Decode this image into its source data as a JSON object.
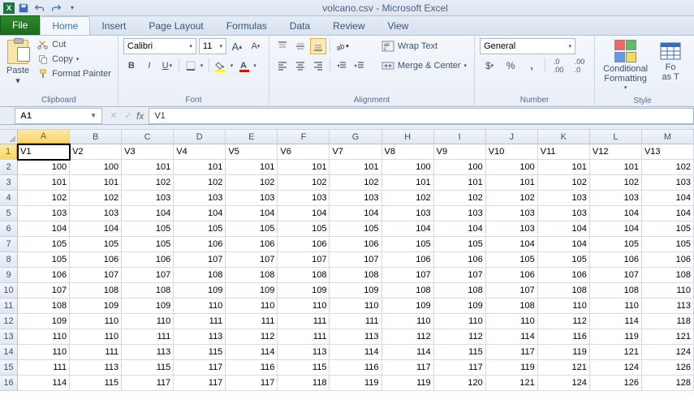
{
  "title": "volcano.csv - Microsoft Excel",
  "tabs": {
    "file": "File",
    "home": "Home",
    "insert": "Insert",
    "page_layout": "Page Layout",
    "formulas": "Formulas",
    "data": "Data",
    "review": "Review",
    "view": "View"
  },
  "clipboard": {
    "paste": "Paste",
    "cut": "Cut",
    "copy": "Copy",
    "format_painter": "Format Painter",
    "label": "Clipboard"
  },
  "font": {
    "name": "Calibri",
    "size": "11",
    "label": "Font"
  },
  "alignment": {
    "wrap": "Wrap Text",
    "merge": "Merge & Center",
    "label": "Alignment"
  },
  "number": {
    "format": "General",
    "label": "Number"
  },
  "styles": {
    "conditional": "Conditional\nFormatting",
    "format_as": "Fo\nas T",
    "label": "Style"
  },
  "namebox": "A1",
  "formula": "V1",
  "columns": [
    "A",
    "B",
    "C",
    "D",
    "E",
    "F",
    "G",
    "H",
    "I",
    "J",
    "K",
    "L",
    "M"
  ],
  "row_numbers": [
    "1",
    "2",
    "3",
    "4",
    "5",
    "6",
    "7",
    "8",
    "9",
    "10",
    "11",
    "12",
    "13",
    "14",
    "15",
    "16"
  ],
  "chart_data": {
    "type": "table",
    "headers": [
      "V1",
      "V2",
      "V3",
      "V4",
      "V5",
      "V6",
      "V7",
      "V8",
      "V9",
      "V10",
      "V11",
      "V12",
      "V13"
    ],
    "rows": [
      [
        100,
        100,
        101,
        101,
        101,
        101,
        101,
        100,
        100,
        100,
        101,
        101,
        102
      ],
      [
        101,
        101,
        102,
        102,
        102,
        102,
        102,
        101,
        101,
        101,
        102,
        102,
        103
      ],
      [
        102,
        102,
        103,
        103,
        103,
        103,
        103,
        102,
        102,
        102,
        103,
        103,
        104
      ],
      [
        103,
        103,
        104,
        104,
        104,
        104,
        104,
        103,
        103,
        103,
        103,
        104,
        104
      ],
      [
        104,
        104,
        105,
        105,
        105,
        105,
        105,
        104,
        104,
        103,
        104,
        104,
        105
      ],
      [
        105,
        105,
        105,
        106,
        106,
        106,
        106,
        105,
        105,
        104,
        104,
        105,
        105
      ],
      [
        105,
        106,
        106,
        107,
        107,
        107,
        107,
        106,
        106,
        105,
        105,
        106,
        106
      ],
      [
        106,
        107,
        107,
        108,
        108,
        108,
        108,
        107,
        107,
        106,
        106,
        107,
        108
      ],
      [
        107,
        108,
        108,
        109,
        109,
        109,
        109,
        108,
        108,
        107,
        108,
        108,
        110
      ],
      [
        108,
        109,
        109,
        110,
        110,
        110,
        110,
        109,
        109,
        108,
        110,
        110,
        113
      ],
      [
        109,
        110,
        110,
        111,
        111,
        111,
        111,
        110,
        110,
        110,
        112,
        114,
        118
      ],
      [
        110,
        110,
        111,
        113,
        112,
        111,
        113,
        112,
        112,
        114,
        116,
        119,
        121
      ],
      [
        110,
        111,
        113,
        115,
        114,
        113,
        114,
        114,
        115,
        117,
        119,
        121,
        124
      ],
      [
        111,
        113,
        115,
        117,
        116,
        115,
        116,
        117,
        117,
        119,
        121,
        124,
        126
      ],
      [
        114,
        115,
        117,
        117,
        117,
        118,
        119,
        119,
        120,
        121,
        124,
        126,
        128
      ]
    ]
  }
}
